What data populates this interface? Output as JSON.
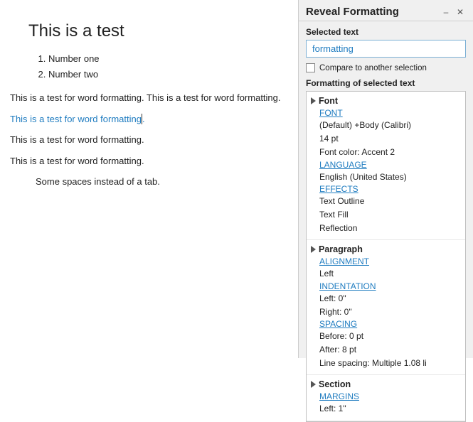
{
  "document": {
    "heading": "This is a test",
    "list_items": [
      "Number one",
      "Number two"
    ],
    "paragraphs": [
      "This is a test for word formatting. This is a test for word formatting.",
      "This is a test for word formatting.",
      "",
      "This is a test for word formatting.",
      "",
      "Some spaces instead of a tab."
    ],
    "link_para": "This is a test for word formatting."
  },
  "panel": {
    "title": "Reveal Formatting",
    "close_btn": "✕",
    "collapse_btn": "–",
    "selected_text_label": "Selected text",
    "selected_text_value": "formatting",
    "compare_label": "Compare to another selection",
    "formatting_header": "Formatting of selected text",
    "sections": [
      {
        "title": "Font",
        "items": [
          {
            "type": "link",
            "text": "FONT"
          },
          {
            "type": "value",
            "text": "(Default) +Body (Calibri)"
          },
          {
            "type": "value",
            "text": "14 pt"
          },
          {
            "type": "value",
            "text": "Font color: Accent 2"
          },
          {
            "type": "link",
            "text": "LANGUAGE"
          },
          {
            "type": "value",
            "text": "English (United States)"
          },
          {
            "type": "link",
            "text": "EFFECTS"
          },
          {
            "type": "value",
            "text": "Text Outline"
          },
          {
            "type": "value",
            "text": "Text Fill"
          },
          {
            "type": "value",
            "text": "Reflection"
          }
        ]
      },
      {
        "title": "Paragraph",
        "items": [
          {
            "type": "link",
            "text": "ALIGNMENT"
          },
          {
            "type": "value",
            "text": "Left"
          },
          {
            "type": "link",
            "text": "INDENTATION"
          },
          {
            "type": "value",
            "text": "Left:  0\""
          },
          {
            "type": "value",
            "text": "Right:  0\""
          },
          {
            "type": "link",
            "text": "SPACING"
          },
          {
            "type": "value",
            "text": "Before:  0 pt"
          },
          {
            "type": "value",
            "text": "After:  8 pt"
          },
          {
            "type": "value",
            "text": "Line spacing:  Multiple 1.08 li"
          }
        ]
      },
      {
        "title": "Section",
        "items": [
          {
            "type": "link",
            "text": "MARGINS"
          },
          {
            "type": "value",
            "text": "Left:  1\""
          }
        ]
      }
    ]
  }
}
